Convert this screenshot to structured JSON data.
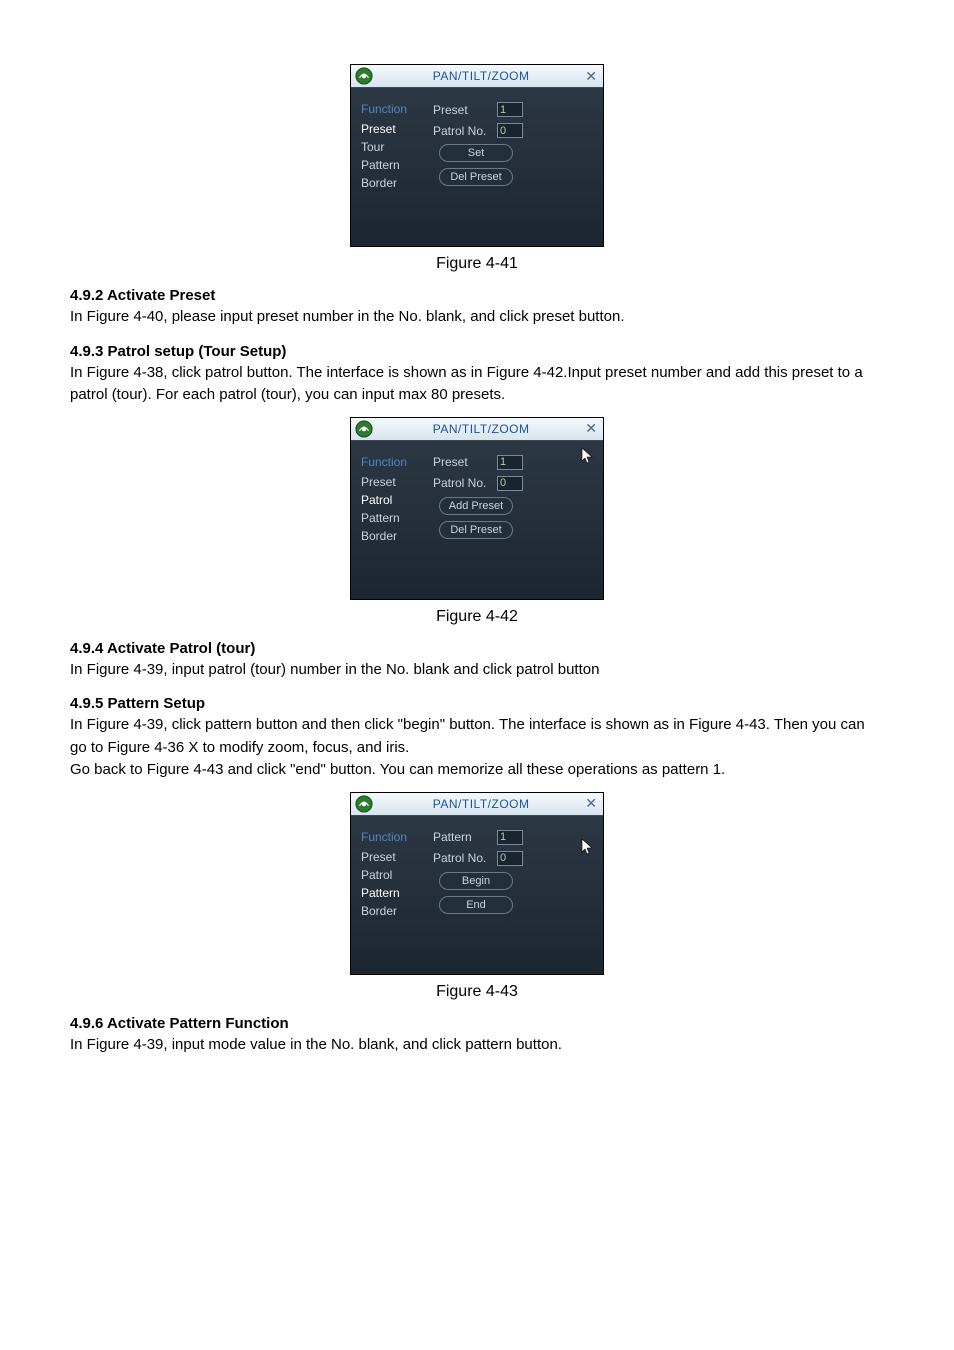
{
  "figures": {
    "f41": {
      "title": "PAN/TILT/ZOOM",
      "caption": "Figure 4-41",
      "function_header": "Function",
      "menu": [
        "Preset",
        "Tour",
        "Pattern",
        "Border"
      ],
      "selected": "Preset",
      "field1_label": "Preset",
      "field1_value": "1",
      "field2_label": "Patrol No.",
      "field2_value": "0",
      "btn1": "Set",
      "btn2": "Del Preset",
      "show_cursor": false
    },
    "f42": {
      "title": "PAN/TILT/ZOOM",
      "caption": "Figure 4-42",
      "function_header": "Function",
      "menu": [
        "Preset",
        "Patrol",
        "Pattern",
        "Border"
      ],
      "selected": "Patrol",
      "field1_label": "Preset",
      "field1_value": "1",
      "field2_label": "Patrol No.",
      "field2_value": "0",
      "btn1": "Add Preset",
      "btn2": "Del Preset",
      "show_cursor": true
    },
    "f43": {
      "title": "PAN/TILT/ZOOM",
      "caption": "Figure 4-43",
      "function_header": "Function",
      "menu": [
        "Preset",
        "Patrol",
        "Pattern",
        "Border"
      ],
      "selected": "Pattern",
      "field1_label": "Pattern",
      "field1_value": "1",
      "field2_label": "Patrol No.",
      "field2_value": "0",
      "btn1": "Begin",
      "btn2": "End",
      "show_cursor": true
    }
  },
  "sections": {
    "s492": {
      "title": "4.9.2 Activate Preset",
      "body": "In Figure 4-40, please input preset number in the No. blank, and click preset button."
    },
    "s493": {
      "title": "4.9.3 Patrol setup (Tour Setup)",
      "body": "In Figure 4-38, click patrol button. The interface is shown as in Figure 4-42.Input preset number and add this preset to a patrol (tour). For each patrol (tour), you can input max 80 presets."
    },
    "s494": {
      "title": "4.9.4 Activate Patrol (tour)",
      "body": "In  Figure 4-39, input patrol (tour) number in the No. blank and click patrol button"
    },
    "s495": {
      "title": "4.9.5 Pattern Setup",
      "body": "In Figure 4-39, click pattern button and then click \"begin\" button. The interface is shown as in Figure 4-43. Then you can go to Figure 4-36 X to modify zoom, focus, and iris.\nGo back to Figure 4-43 and click \"end\" button. You can memorize all these operations as pattern 1."
    },
    "s496": {
      "title": "4.9.6 Activate Pattern Function",
      "body": "In  Figure 4-39, input mode value in the No. blank, and click pattern button."
    }
  }
}
